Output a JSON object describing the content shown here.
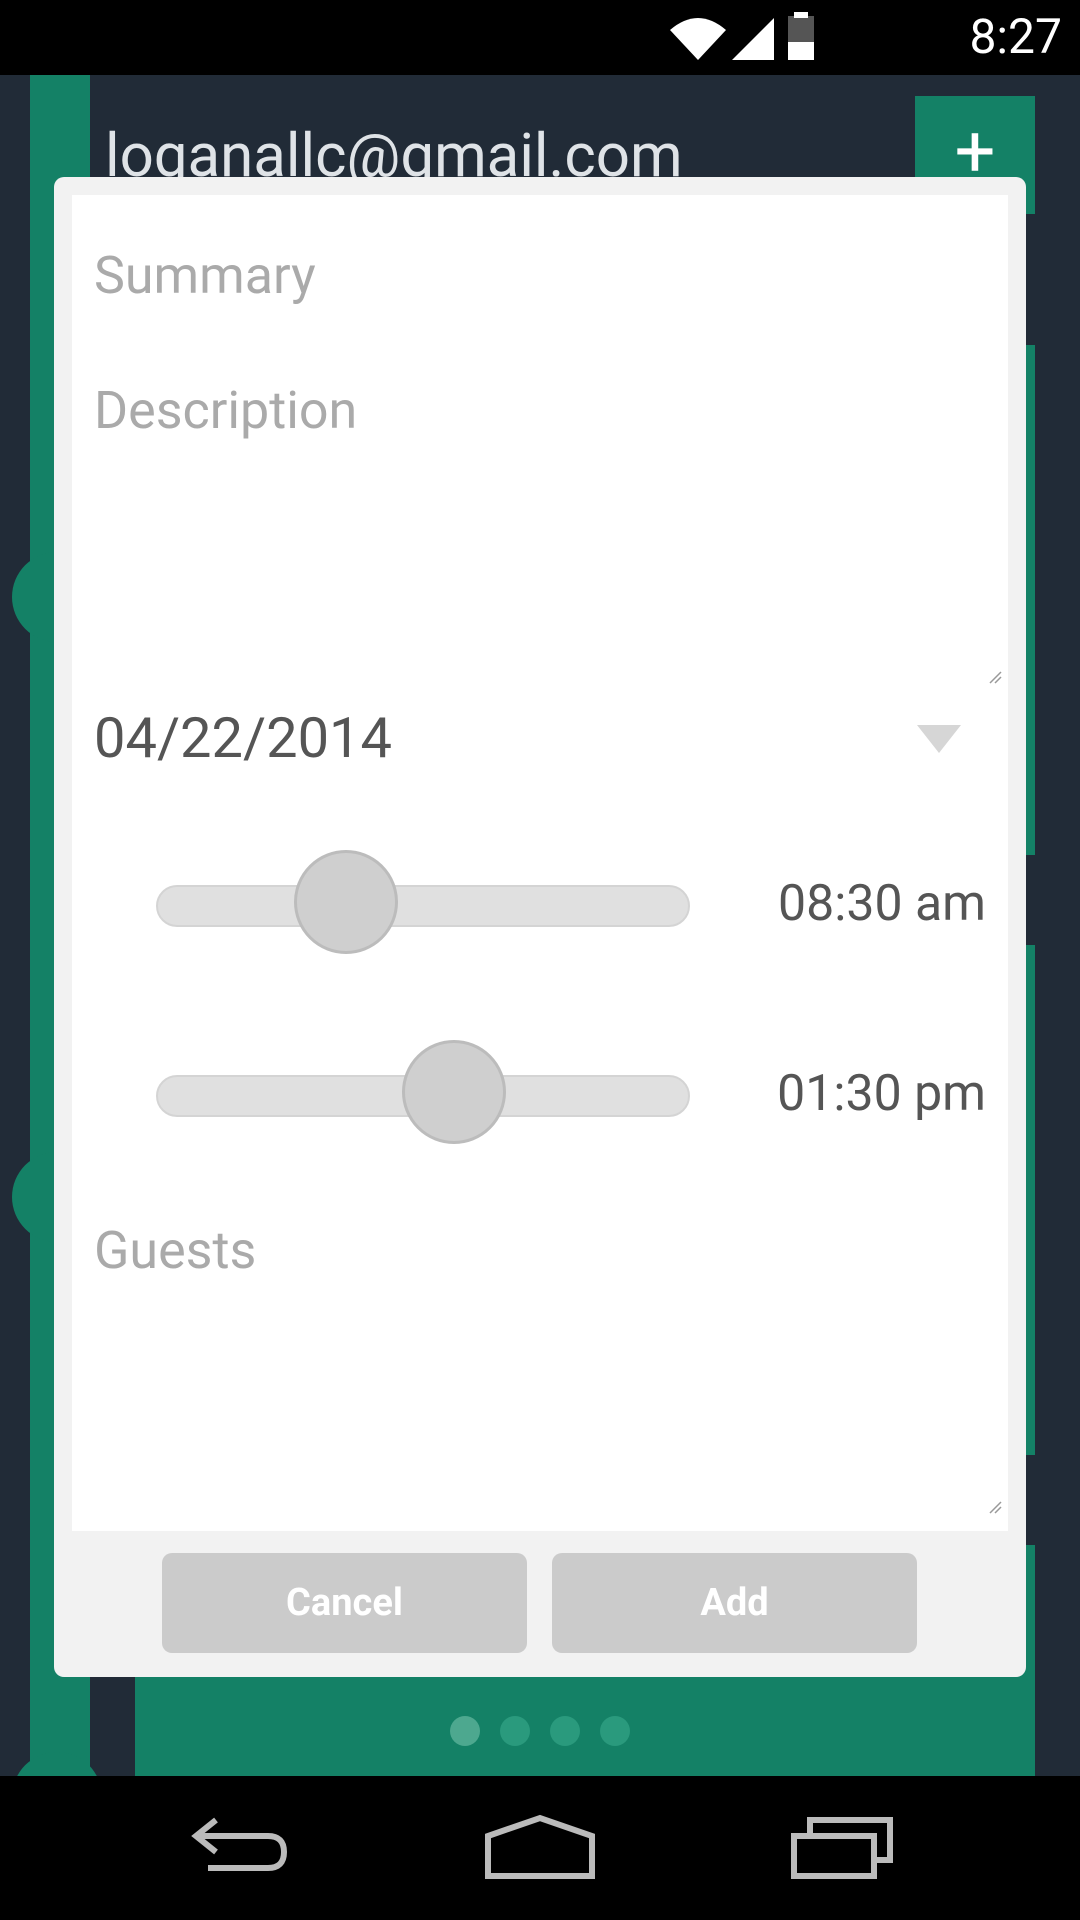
{
  "status_bar": {
    "time": "8:27"
  },
  "background": {
    "account_email": "loganallc@gmail.com",
    "add_label": "+",
    "pager_pages": 4
  },
  "dialog": {
    "summary_placeholder": "Summary",
    "description_placeholder": "Description",
    "date": "04/22/2014",
    "start_time": "08:30 am",
    "end_time": "01:30 pm",
    "guests_placeholder": "Guests",
    "cancel_label": "Cancel",
    "add_label": "Add"
  },
  "colors": {
    "accent": "#148166",
    "background": "#212b37",
    "dialog": "#f2f2f2",
    "button": "#cbcbcb"
  }
}
